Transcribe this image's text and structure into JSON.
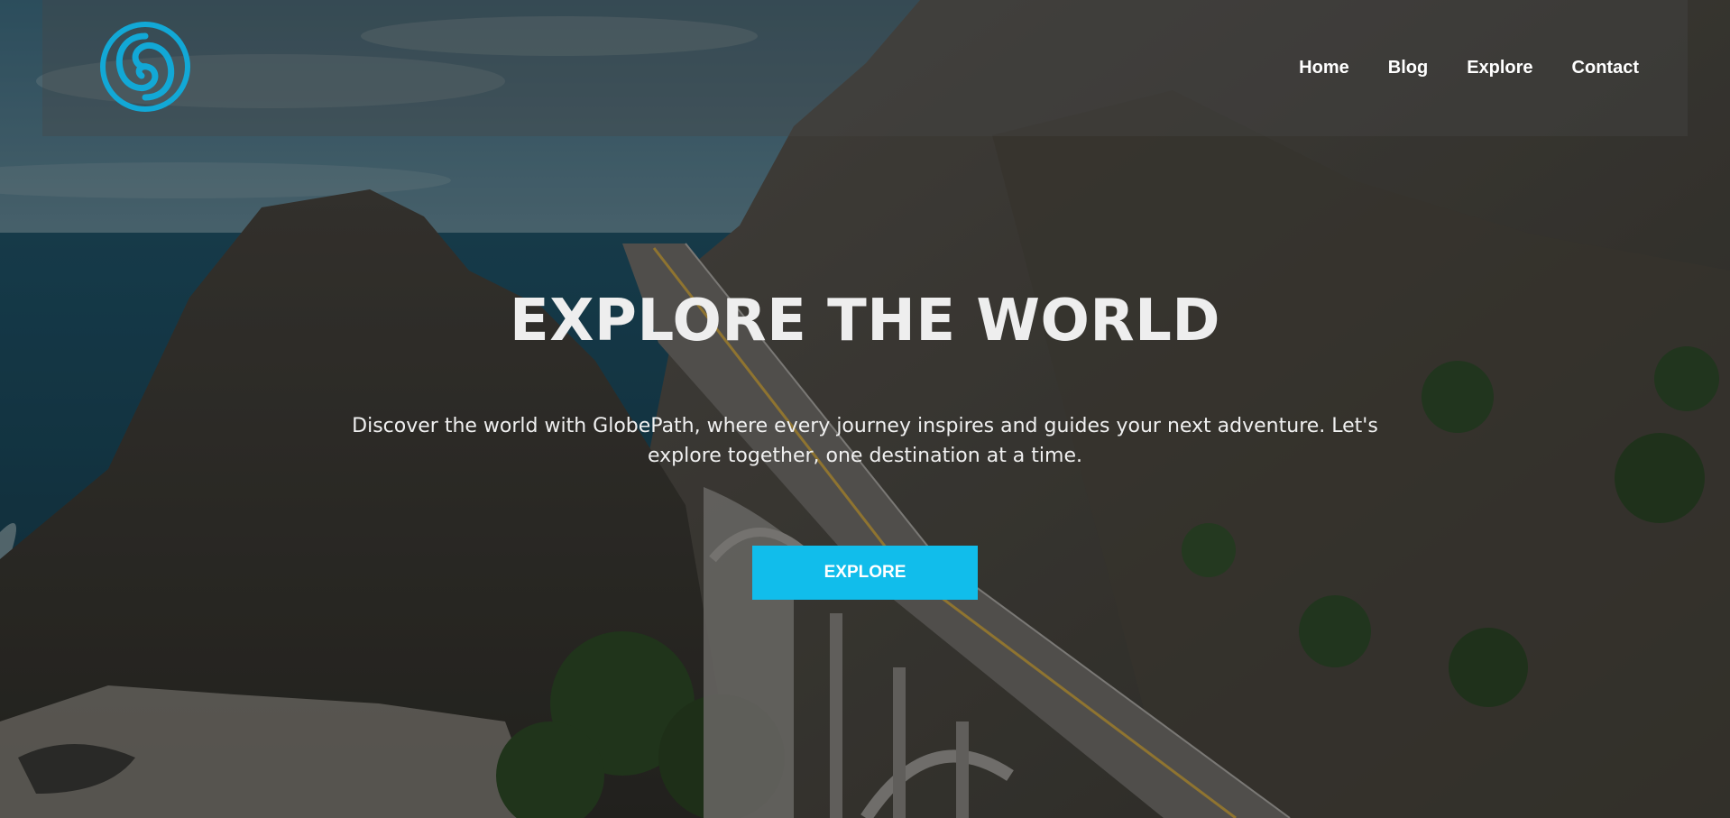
{
  "brand": {
    "logo_icon": "swirl-logo-icon",
    "logo_color": "#12a8d6"
  },
  "nav": {
    "items": [
      {
        "label": "Home"
      },
      {
        "label": "Blog"
      },
      {
        "label": "Explore"
      },
      {
        "label": "Contact"
      }
    ]
  },
  "hero": {
    "headline": "EXPLORE THE WORLD",
    "tagline": "Discover the world with GlobePath, where every journey inspires and guides your next adventure. Let's explore together, one destination at a time.",
    "cta_label": "EXPLORE",
    "accent": "#11bdeb",
    "background": "aerial-coastal-mountain-bridge-photo"
  }
}
